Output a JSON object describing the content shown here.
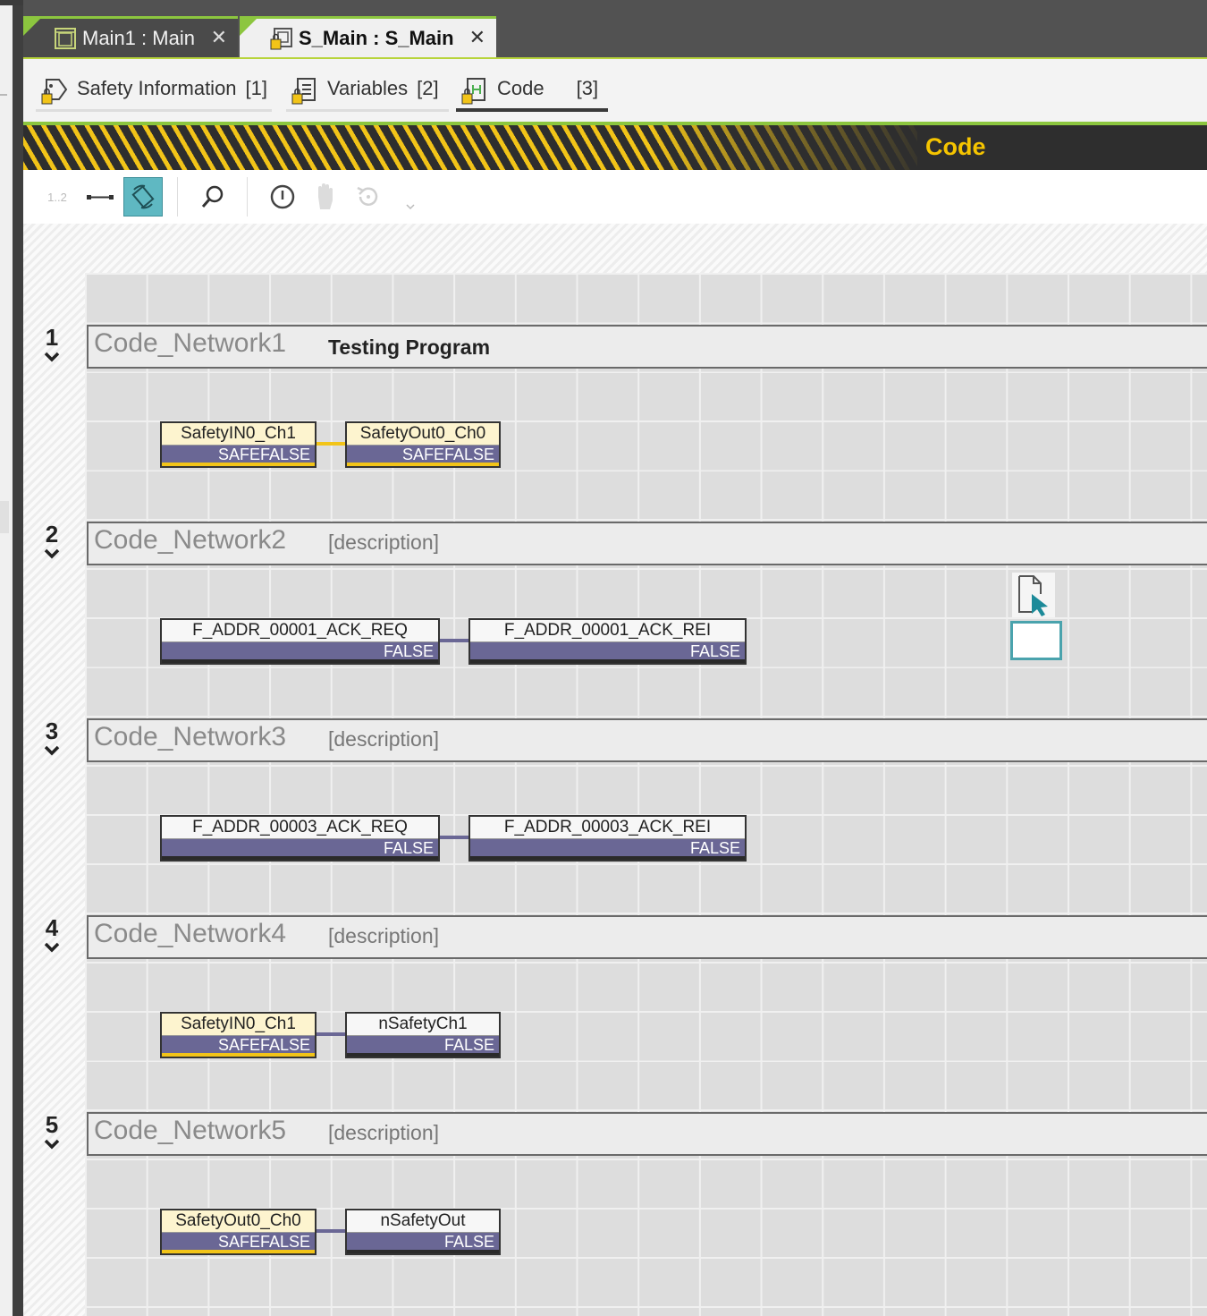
{
  "tabs": [
    {
      "label": "Main1 : Main",
      "close": "✕"
    },
    {
      "label": "S_Main : S_Main",
      "close": "✕"
    }
  ],
  "subtabs": [
    {
      "label": "Safety Information",
      "count": "[1]"
    },
    {
      "label": "Variables",
      "count": "[2]"
    },
    {
      "label": "Code",
      "count": "[3]"
    }
  ],
  "section_title": "Code",
  "toolbar": {
    "line_numbers_label": "1..2"
  },
  "networks": [
    {
      "number": "1",
      "name": "Code_Network1",
      "description": "Testing Program",
      "left": {
        "name": "SafetyIN0_Ch1",
        "value": "SAFEFALSE",
        "safe": true
      },
      "right": {
        "name": "SafetyOut0_Ch0",
        "value": "SAFEFALSE",
        "safe": true
      }
    },
    {
      "number": "2",
      "name": "Code_Network2",
      "description": "[description]",
      "left": {
        "name": "F_ADDR_00001_ACK_REQ",
        "value": "FALSE",
        "safe": false
      },
      "right": {
        "name": "F_ADDR_00001_ACK_REI",
        "value": "FALSE",
        "safe": false
      }
    },
    {
      "number": "3",
      "name": "Code_Network3",
      "description": "[description]",
      "left": {
        "name": "F_ADDR_00003_ACK_REQ",
        "value": "FALSE",
        "safe": false
      },
      "right": {
        "name": "F_ADDR_00003_ACK_REI",
        "value": "FALSE",
        "safe": false
      }
    },
    {
      "number": "4",
      "name": "Code_Network4",
      "description": "[description]",
      "left": {
        "name": "SafetyIN0_Ch1",
        "value": "SAFEFALSE",
        "safe": true
      },
      "right": {
        "name": "nSafetyCh1",
        "value": "FALSE",
        "safe": false
      }
    },
    {
      "number": "5",
      "name": "Code_Network5",
      "description": "[description]",
      "left": {
        "name": "SafetyOut0_Ch0",
        "value": "SAFEFALSE",
        "safe": true
      },
      "right": {
        "name": "nSafetyOut",
        "value": "FALSE",
        "safe": false
      }
    }
  ],
  "colors": {
    "accent_green": "#8cc63f",
    "safety_yellow": "#f2c418",
    "code_title": "#f5c400",
    "variable_value_bar": "#6a6795",
    "selected_tool_bg": "#5fb8c2"
  }
}
